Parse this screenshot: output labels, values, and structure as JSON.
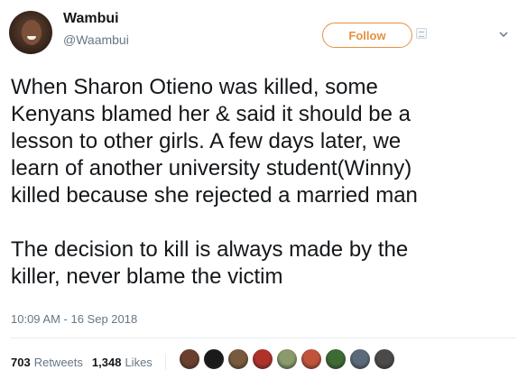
{
  "user": {
    "name": "Wambui",
    "handle": "@Waambui"
  },
  "follow": {
    "label": "Follow",
    "accent": "#e6903f"
  },
  "tweet": {
    "paragraphs": [
      "When Sharon Otieno was killed, some\nKenyans blamed her & said it should be a\nlesson to other girls. A few days later, we\nlearn of another university student(Winny)\nkilled because she rejected a married man",
      "The decision to kill is always made by the\nkiller, never blame the victim"
    ],
    "timestamp": "10:09 AM - 16 Sep 2018"
  },
  "stats": {
    "retweets_count": "703",
    "retweets_label": "Retweets",
    "likes_count": "1,348",
    "likes_label": "Likes"
  },
  "likers": {
    "colors": [
      "#6b3f2e",
      "#1a1a1a",
      "#7a5a3c",
      "#b0302a",
      "#8a9a6a",
      "#c0533a",
      "#3e6a34",
      "#5a6a7a",
      "#4a4a4a"
    ]
  },
  "icons": {
    "follow_icon": "person-plus-icon",
    "caret": "chevron-down-icon"
  }
}
